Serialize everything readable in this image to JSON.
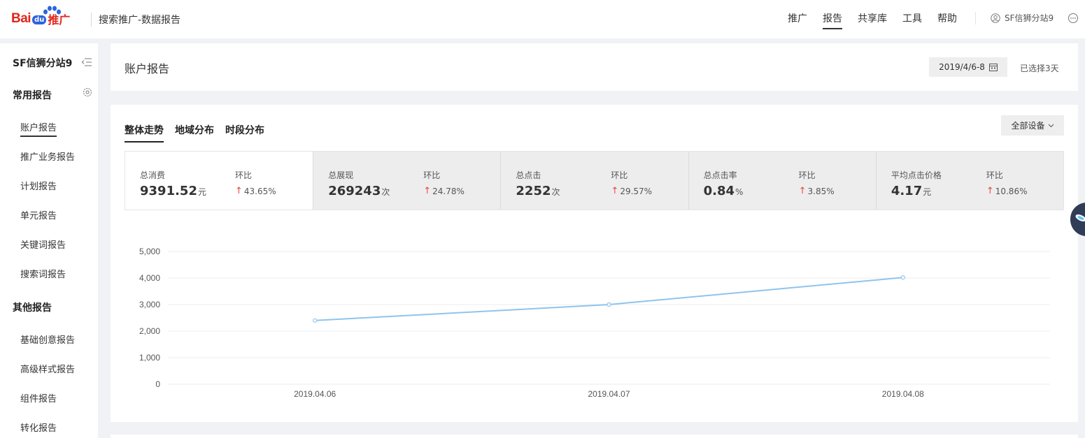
{
  "topbar": {
    "logo_bai": "Bai",
    "logo_du": "du",
    "logo_tuiguang": "推广",
    "app_title": "搜索推广-数据报告",
    "nav": [
      {
        "label": "推广",
        "active": false
      },
      {
        "label": "报告",
        "active": true
      },
      {
        "label": "共享库",
        "active": false
      },
      {
        "label": "工具",
        "active": false
      },
      {
        "label": "帮助",
        "active": false
      }
    ],
    "user": "SF信狮分站9"
  },
  "sidebar": {
    "account": "SF信狮分站9",
    "groups": [
      {
        "title": "常用报告",
        "items": [
          "账户报告",
          "推广业务报告",
          "计划报告",
          "单元报告",
          "关键词报告",
          "搜索词报告"
        ]
      },
      {
        "title": "其他报告",
        "items": [
          "基础创意报告",
          "高级样式报告",
          "组件报告",
          "转化报告"
        ]
      }
    ],
    "active_item": "账户报告"
  },
  "header": {
    "title": "账户报告",
    "date_range": "2019/4/6-8",
    "selected_days": "已选择3天"
  },
  "main": {
    "tabs": [
      {
        "label": "整体走势",
        "active": true
      },
      {
        "label": "地域分布",
        "active": false
      },
      {
        "label": "时段分布",
        "active": false
      }
    ],
    "device_select": "全部设备",
    "metrics": [
      {
        "label": "总消费",
        "value": "9391.52",
        "unit": "元",
        "cmp_label": "环比",
        "cmp": "43.65%",
        "selected": true
      },
      {
        "label": "总展现",
        "value": "269243",
        "unit": "次",
        "cmp_label": "环比",
        "cmp": "24.78%",
        "selected": false
      },
      {
        "label": "总点击",
        "value": "2252",
        "unit": "次",
        "cmp_label": "环比",
        "cmp": "29.57%",
        "selected": false
      },
      {
        "label": "总点击率",
        "value": "0.84",
        "unit": "%",
        "cmp_label": "环比",
        "cmp": "3.85%",
        "selected": false
      },
      {
        "label": "平均点击价格",
        "value": "4.17",
        "unit": "元",
        "cmp_label": "环比",
        "cmp": "10.86%",
        "selected": false
      }
    ]
  },
  "colors": {
    "accent_red": "#e1251b",
    "baidu_blue": "#2d63dd",
    "up_arrow": "#e8483b",
    "line": "#8ec4ee"
  },
  "chart_data": {
    "type": "line",
    "categories": [
      "2019.04.06",
      "2019.04.07",
      "2019.04.08"
    ],
    "values": [
      2400,
      3000,
      4020
    ],
    "y_ticks": [
      "5,000",
      "4,000",
      "3,000",
      "2,000",
      "1,000",
      "0"
    ],
    "ylim": [
      0,
      5000
    ],
    "grid": true,
    "legend": "none"
  }
}
